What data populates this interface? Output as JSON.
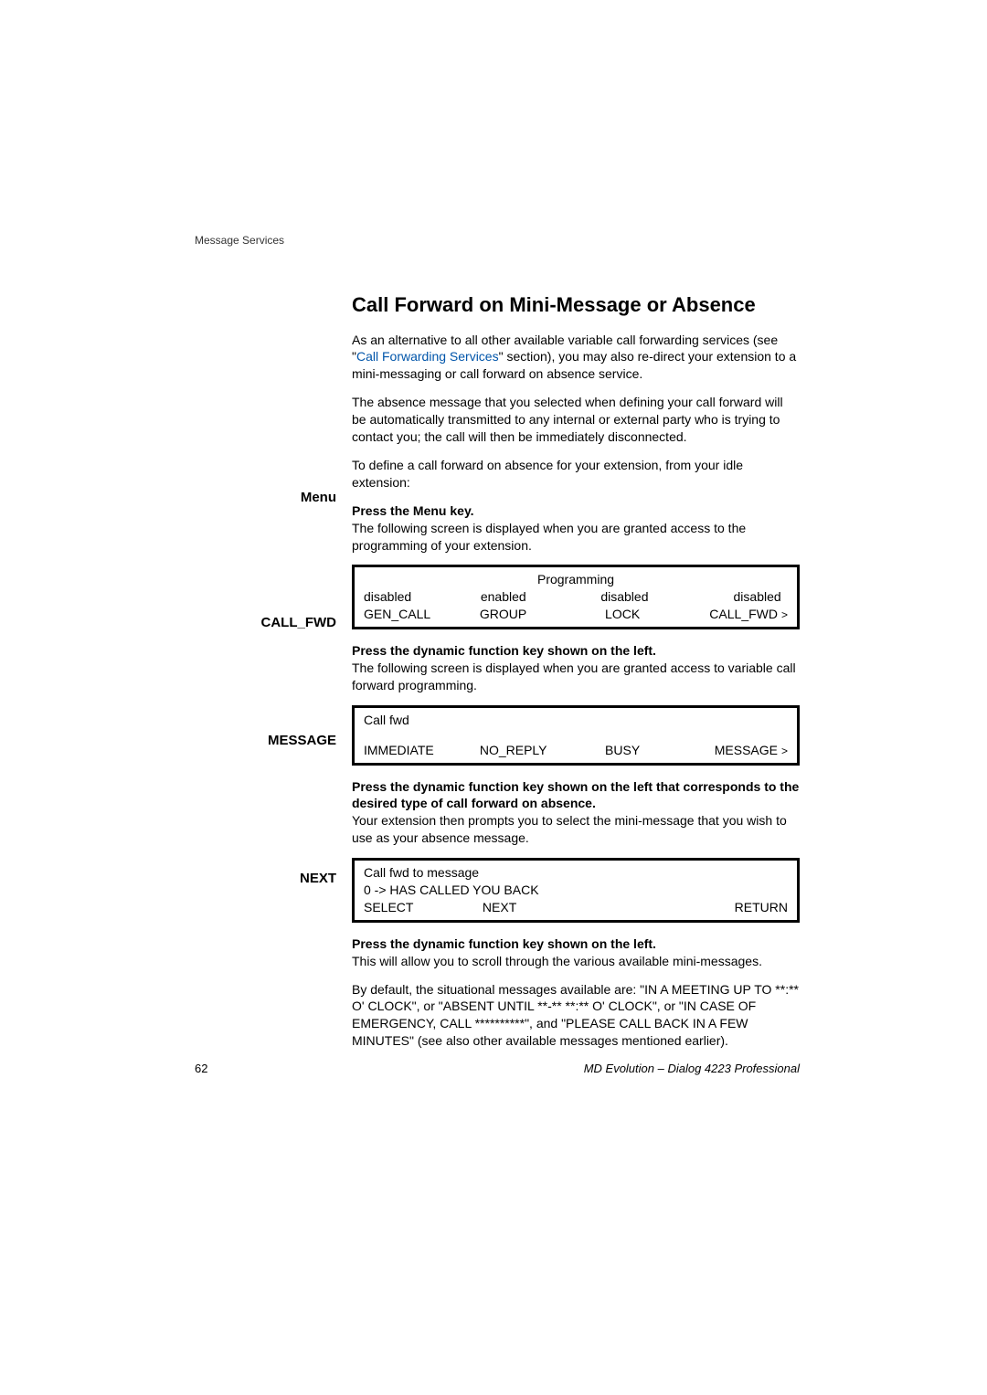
{
  "header": "Message Services",
  "title": "Call Forward on Mini-Message or Absence",
  "p1_pre": "As an alternative to all other available variable call forwarding services (see \"",
  "p1_link": "Call Forwarding Services",
  "p1_post": "\" section), you may also re-direct your extension to a mini-messaging or call forward on absence service.",
  "p2": "The absence message that you selected when defining your call forward will be automatically transmitted to any internal or external party who is trying to contact you; the call will then be immediately disconnected.",
  "p3": "To define a call forward on absence for your extension, from your idle extension:",
  "menu": {
    "label": "Menu",
    "instr": "Press the Menu key.",
    "desc": "The following screen is displayed when you are granted access to the programming of your extension."
  },
  "screen1": {
    "title": "Programming",
    "r1c1": "disabled",
    "r1c2": "enabled",
    "r1c3": "disabled",
    "r1c4": "disabled",
    "r2c1": "GEN_CALL",
    "r2c2": "GROUP",
    "r2c3": "LOCK",
    "r2c4": "CALL_FWD",
    "arrow": ">"
  },
  "callfwd": {
    "label": "CALL_FWD",
    "instr": "Press the dynamic function key shown on the left.",
    "desc": "The following screen is displayed when you are granted access to variable call forward programming."
  },
  "screen2": {
    "title": "Call fwd",
    "c1": "IMMEDIATE",
    "c2": "NO_REPLY",
    "c3": "BUSY",
    "c4": "MESSAGE",
    "arrow": ">"
  },
  "message": {
    "label": "MESSAGE",
    "instr": "Press the dynamic function key shown on the left that corresponds to the desired type of call forward on absence.",
    "desc": "Your extension then prompts you to select the mini-message that you wish to use as your absence message."
  },
  "screen3": {
    "line1": "Call fwd to message",
    "line2": "0 -> HAS CALLED YOU BACK",
    "c1": "SELECT",
    "c2": "NEXT",
    "c4": "RETURN"
  },
  "next": {
    "label": "NEXT",
    "instr": "Press the dynamic function key shown on the left.",
    "desc": "This will allow you to scroll through the various available mini-messages.",
    "p2": "By default, the situational messages available are: \"IN A MEETING UP TO **:** O' CLOCK\", or \"ABSENT UNTIL **-**  **:** O' CLOCK\", or \"IN CASE OF EMERGENCY, CALL **********\", and \"PLEASE CALL BACK IN A FEW MINUTES\" (see also other available messages mentioned earlier)."
  },
  "page_number": "62",
  "footer_right": "MD Evolution – Dialog 4223 Professional"
}
